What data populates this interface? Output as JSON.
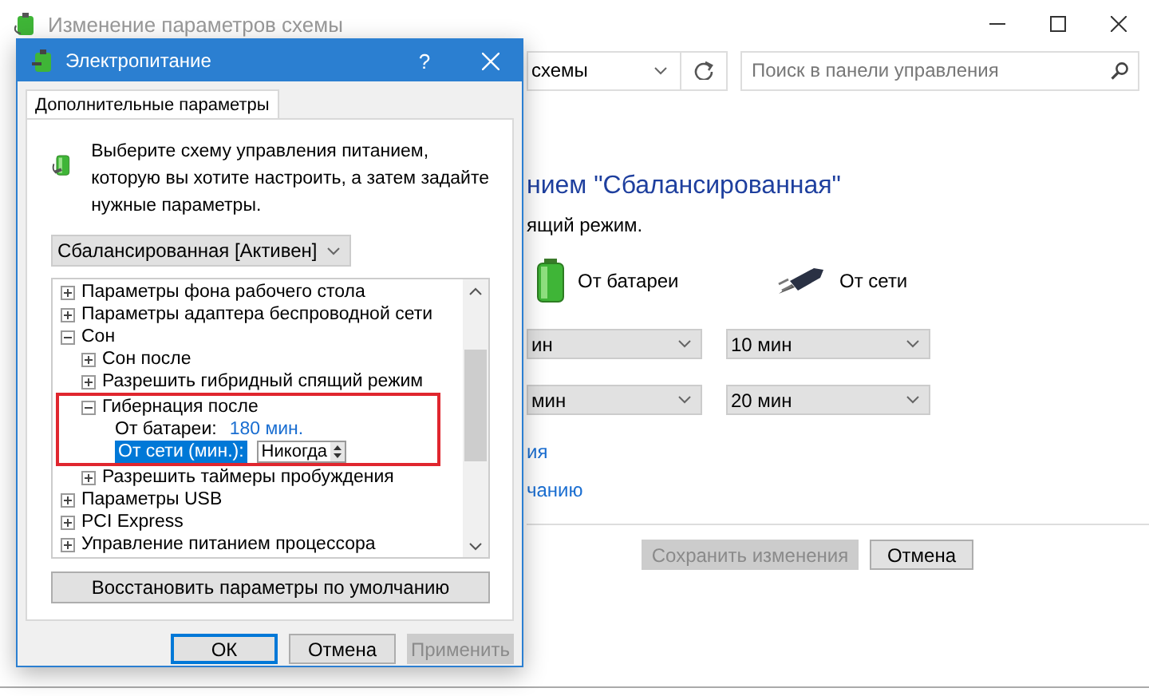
{
  "background_window": {
    "title": "Изменение параметров схемы",
    "address": "схемы",
    "search": {
      "placeholder": "Поиск в панели управления"
    },
    "heading": "нием \"Сбалансированная\"",
    "subtitle": "ящий режим.",
    "columns": [
      {
        "kind": "battery",
        "label": "От батареи"
      },
      {
        "kind": "plug",
        "label": "От сети"
      }
    ],
    "settings_rows": [
      [
        "ин",
        "10 мин"
      ],
      [
        "мин",
        "20 мин"
      ]
    ],
    "links": [
      "ия",
      "чанию"
    ],
    "buttons": [
      {
        "label": "Сохранить изменения",
        "disabled": true
      },
      {
        "label": "Отмена",
        "disabled": false
      }
    ]
  },
  "dialog": {
    "title": "Электропитание",
    "help": "?",
    "tabs": [
      {
        "label": "Дополнительные параметры",
        "selected": true
      }
    ],
    "intro": "Выберите схему управления питанием, которую вы хотите настроить, а затем задайте нужные параметры.",
    "plan": "Сбалансированная [Активен]",
    "tree": [
      {
        "label": "Параметры фона рабочего стола",
        "expanded": false
      },
      {
        "label": "Параметры адаптера беспроводной сети",
        "expanded": false
      },
      {
        "label": "Сон",
        "expanded": true,
        "children": [
          {
            "label": "Сон после",
            "expanded": false
          },
          {
            "label": "Разрешить гибридный спящий режим",
            "expanded": false
          },
          {
            "label": "Гибернация после",
            "expanded": true,
            "highlighted": true,
            "children": [
              {
                "kind": "value",
                "label": "От батареи:",
                "value": "180 мин.",
                "selected": false
              },
              {
                "kind": "spinner",
                "label": "От сети (мин.):",
                "value": "Никогда",
                "selected": true
              }
            ]
          },
          {
            "label": "Разрешить таймеры пробуждения",
            "expanded": false
          }
        ]
      },
      {
        "label": "Параметры USB",
        "expanded": false
      },
      {
        "label": "PCI Express",
        "expanded": false
      },
      {
        "label": "Управление питанием процессора",
        "expanded": false
      }
    ],
    "restore_button": "Восстановить параметры по умолчанию",
    "buttons": [
      {
        "label": "ОК",
        "default": true,
        "disabled": false
      },
      {
        "label": "Отмена",
        "default": false,
        "disabled": false
      },
      {
        "label": "Применить",
        "default": false,
        "disabled": true
      }
    ]
  }
}
